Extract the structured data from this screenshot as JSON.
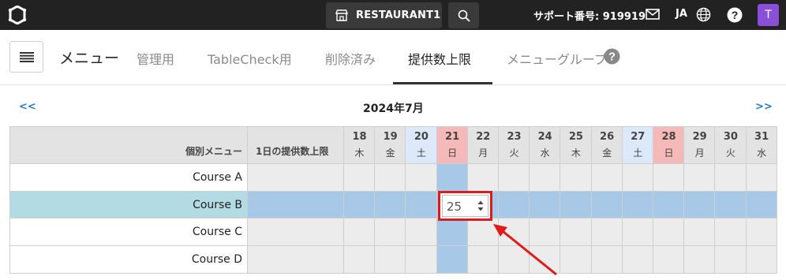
{
  "topbar": {
    "restaurant_name": "RESTAURANT1",
    "support_text": "サポート番号: 919919",
    "language": "JA",
    "avatar_initial": "T"
  },
  "menu": {
    "title": "メニュー",
    "tabs": [
      {
        "label": "管理用"
      },
      {
        "label": "TableCheck用"
      },
      {
        "label": "削除済み"
      },
      {
        "label": "提供数上限",
        "active": true
      },
      {
        "label": "メニューグループ"
      }
    ]
  },
  "calendar": {
    "prev_label": "<<",
    "next_label": ">>",
    "month_label": "2024年7月",
    "header_item": "個別メニュー",
    "header_daily": "1日の提供数上限",
    "days": [
      {
        "num": "18",
        "dow": "木",
        "type": "weekday"
      },
      {
        "num": "19",
        "dow": "金",
        "type": "weekday"
      },
      {
        "num": "20",
        "dow": "土",
        "type": "saturday"
      },
      {
        "num": "21",
        "dow": "日",
        "type": "sunday"
      },
      {
        "num": "22",
        "dow": "月",
        "type": "weekday"
      },
      {
        "num": "23",
        "dow": "火",
        "type": "weekday"
      },
      {
        "num": "24",
        "dow": "水",
        "type": "weekday"
      },
      {
        "num": "25",
        "dow": "木",
        "type": "weekday"
      },
      {
        "num": "26",
        "dow": "金",
        "type": "weekday"
      },
      {
        "num": "27",
        "dow": "土",
        "type": "saturday"
      },
      {
        "num": "28",
        "dow": "日",
        "type": "sunday"
      },
      {
        "num": "29",
        "dow": "月",
        "type": "weekday"
      },
      {
        "num": "30",
        "dow": "火",
        "type": "weekday"
      },
      {
        "num": "31",
        "dow": "水",
        "type": "weekday"
      }
    ],
    "courses": [
      "Course A",
      "Course B",
      "Course C",
      "Course D"
    ],
    "selected_course_index": 1,
    "selected_day_index": 3,
    "selected_value": "25"
  },
  "colors": {
    "topbar_bg": "#222222",
    "header_bg": "#e3e3e3",
    "saturday_bg": "#dbe9fb",
    "sunday_bg": "#f6b9b9",
    "selected_row_bg": "#b3dbe4",
    "highlight_bg": "#a8c8e8",
    "annotation_red": "#e01b1b",
    "link_blue": "#1b7fc8",
    "avatar_purple": "#8a4fd8"
  }
}
